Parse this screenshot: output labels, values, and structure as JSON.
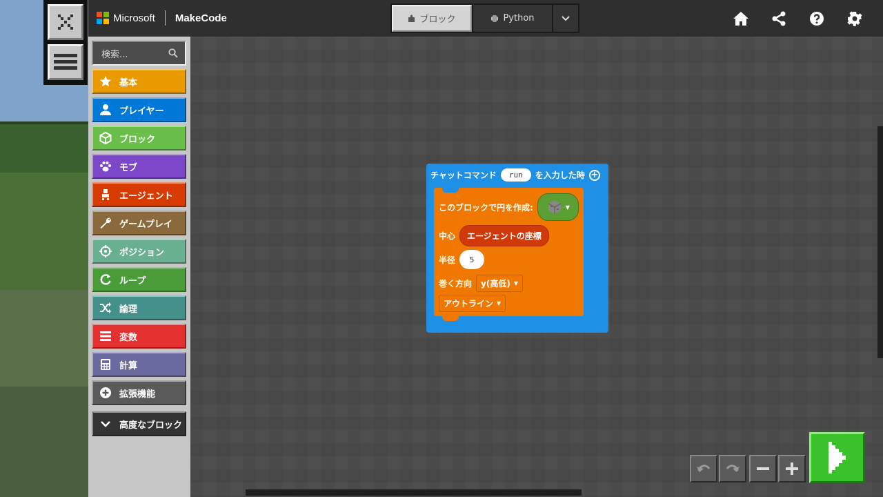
{
  "header": {
    "brand_company": "Microsoft",
    "brand_product": "MakeCode",
    "editor_toggle": {
      "blocks_label": "ブロック",
      "python_label": "Python"
    },
    "colors": {
      "ms_red": "#f25022",
      "ms_green": "#7fba00",
      "ms_blue": "#00a4ef",
      "ms_yellow": "#ffb900"
    }
  },
  "toolbox": {
    "search_placeholder": "検索...",
    "categories": [
      {
        "label": "基本",
        "icon": "star-icon",
        "color": "#e89a00"
      },
      {
        "label": "プレイヤー",
        "icon": "person-icon",
        "color": "#0078d7"
      },
      {
        "label": "ブロック",
        "icon": "cube-icon",
        "color": "#6abf4b"
      },
      {
        "label": "モブ",
        "icon": "paw-icon",
        "color": "#7c48c9"
      },
      {
        "label": "エージェント",
        "icon": "agent-icon",
        "color": "#d83b01"
      },
      {
        "label": "ゲームプレイ",
        "icon": "wrench-icon",
        "color": "#8a6a3c"
      },
      {
        "label": "ポジション",
        "icon": "crosshair-icon",
        "color": "#69b090"
      },
      {
        "label": "ループ",
        "icon": "loop-icon",
        "color": "#4a9c38"
      },
      {
        "label": "論理",
        "icon": "shuffle-icon",
        "color": "#44908a"
      },
      {
        "label": "変数",
        "icon": "list-icon",
        "color": "#e53030"
      },
      {
        "label": "計算",
        "icon": "calculator-icon",
        "color": "#6a6aa0"
      },
      {
        "label": "拡張機能",
        "icon": "plus-circle-icon",
        "color": "#5a5a5a"
      }
    ],
    "advanced_label": "高度なブロック"
  },
  "workspace": {
    "event_block": {
      "prefix": "チャットコマンド",
      "command": "run",
      "suffix": "を入力した時"
    },
    "circle_block": {
      "label": "このブロックで円を作成:",
      "center_label": "中心",
      "center_value": "エージェントの座標",
      "radius_label": "半径",
      "radius_value": "5",
      "orientation_label": "巻く方向",
      "orientation_value": "y(高低)",
      "fill_value": "アウトライン"
    }
  }
}
